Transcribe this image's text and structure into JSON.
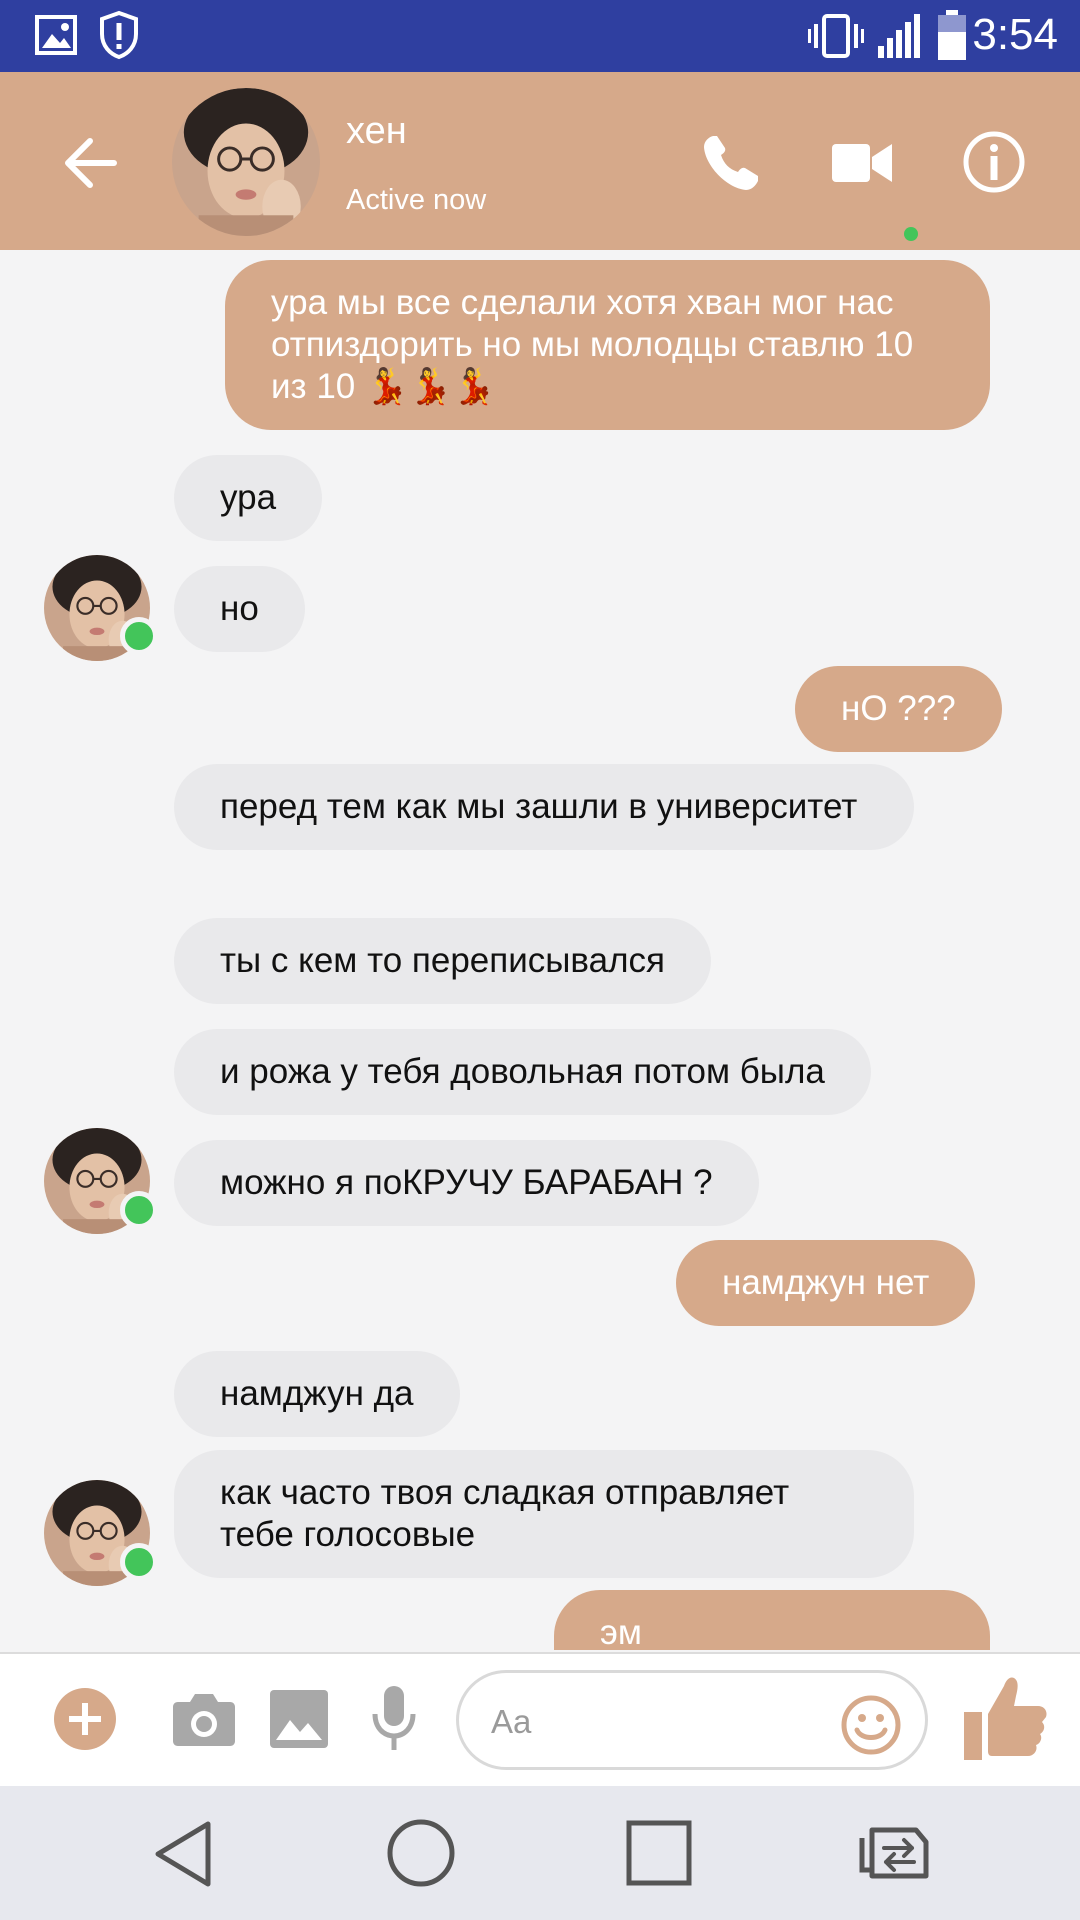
{
  "status_bar": {
    "time": "3:54",
    "icons": [
      "gallery-icon",
      "shield-icon",
      "vibrate-icon",
      "signal-icon",
      "battery-icon"
    ]
  },
  "header": {
    "contact_name": "хен",
    "contact_status": "Active now",
    "icons": [
      "back-arrow-icon",
      "phone-icon",
      "video-call-icon",
      "info-icon"
    ]
  },
  "messages": [
    {
      "dir": "out",
      "text": "ура мы все сделали хотя хван мог нас отпиздорить но мы молодцы ставлю 10 из 10 💃💃💃"
    },
    {
      "dir": "in",
      "text": "ура"
    },
    {
      "dir": "in",
      "text": "но"
    },
    {
      "dir": "out",
      "text": "нО ???"
    },
    {
      "dir": "in",
      "text": "перед тем как мы зашли в университет"
    },
    {
      "dir": "in",
      "text": "ты с кем то переписывался"
    },
    {
      "dir": "in",
      "text": "и рожа у тебя довольная потом была"
    },
    {
      "dir": "in",
      "text": "можно я поКРУЧУ БАРАБАН ?"
    },
    {
      "dir": "out",
      "text": "намджун нет"
    },
    {
      "dir": "in",
      "text": "намджун да"
    },
    {
      "dir": "in",
      "text": "как часто твоя сладкая отправляет тебе голосовые"
    },
    {
      "dir": "out",
      "text": "эм"
    }
  ],
  "composer": {
    "placeholder": "Aa",
    "icons": [
      "plus-icon",
      "camera-icon",
      "image-icon",
      "microphone-icon",
      "emoji-icon",
      "thumbs-up-icon"
    ]
  },
  "nav": {
    "icons": [
      "back-triangle-icon",
      "home-circle-icon",
      "recents-square-icon",
      "switch-apps-icon"
    ]
  },
  "colors": {
    "status_bar": "#2f3fa0",
    "accent": "#d6a98a",
    "incoming_bubble": "#e9e9eb",
    "online": "#43c55a"
  }
}
